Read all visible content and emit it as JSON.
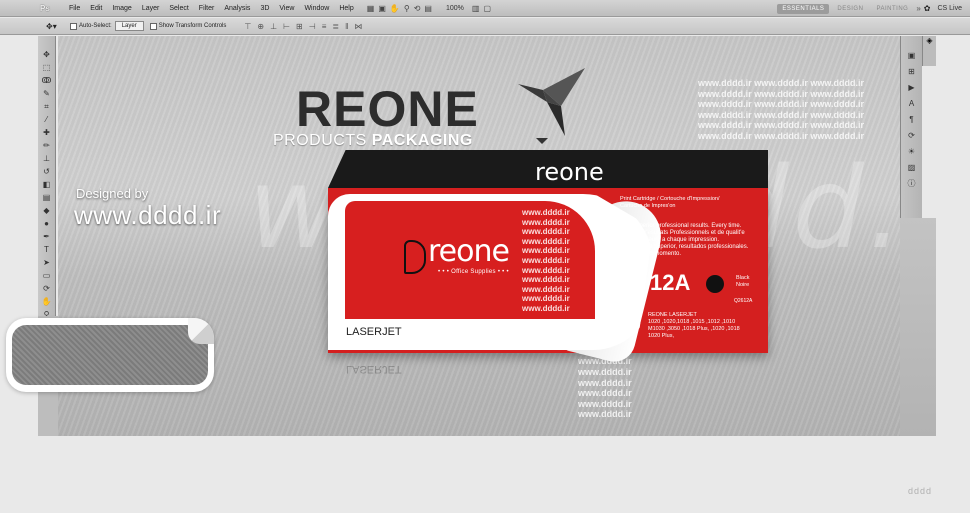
{
  "app": {
    "menu": [
      "File",
      "Edit",
      "Image",
      "Layer",
      "Select",
      "Filter",
      "Analysis",
      "3D",
      "View",
      "Window",
      "Help"
    ],
    "zoom": "100%",
    "workspaces": [
      "ESSENTIALS",
      "DESIGN",
      "PAINTING"
    ],
    "cs_live": "CS Live"
  },
  "options_bar": {
    "auto_select_label": "Auto-Select:",
    "auto_select_value": "Layer",
    "transform_label": "Show Transform Controls"
  },
  "canvas": {
    "brand_title": "REONE",
    "brand_sub_light": "PRODUCTS",
    "brand_sub_bold": "PACKAGING",
    "designed_by": "Designed by",
    "site": "www.dddd.ir",
    "watermark_big": "www.dddd.ir",
    "watermark_line": "www.dddd.ir"
  },
  "box": {
    "logo": "reone",
    "office_supplies": "• • • Office Supplies • • •",
    "top_logo": "reone",
    "laserjet": "LASERJET",
    "print_cartridge": [
      "Print Cartridge / Cortouche d'Impression/",
      "Cartucho de Impres'on"
    ],
    "superior": [
      "Superior professional results. Every time.",
      "Des r'esultats Professionnels et de qualit'e",
      "superieure a chaque impression.",
      "Calidad superior, resultados professionales.",
      "En todo momento."
    ],
    "model": "12A",
    "color_name": [
      "Black",
      "Noire"
    ],
    "sku": "Q2612A",
    "compat": [
      "REONE LASERJET",
      "1020 ,1020,1018 ,1015 ,1012 ,1010",
      "M1030 ,3050 ,1018 Plus, ,1020 ,1018",
      "1020 Plus,"
    ]
  },
  "footer_logo": "dddd"
}
